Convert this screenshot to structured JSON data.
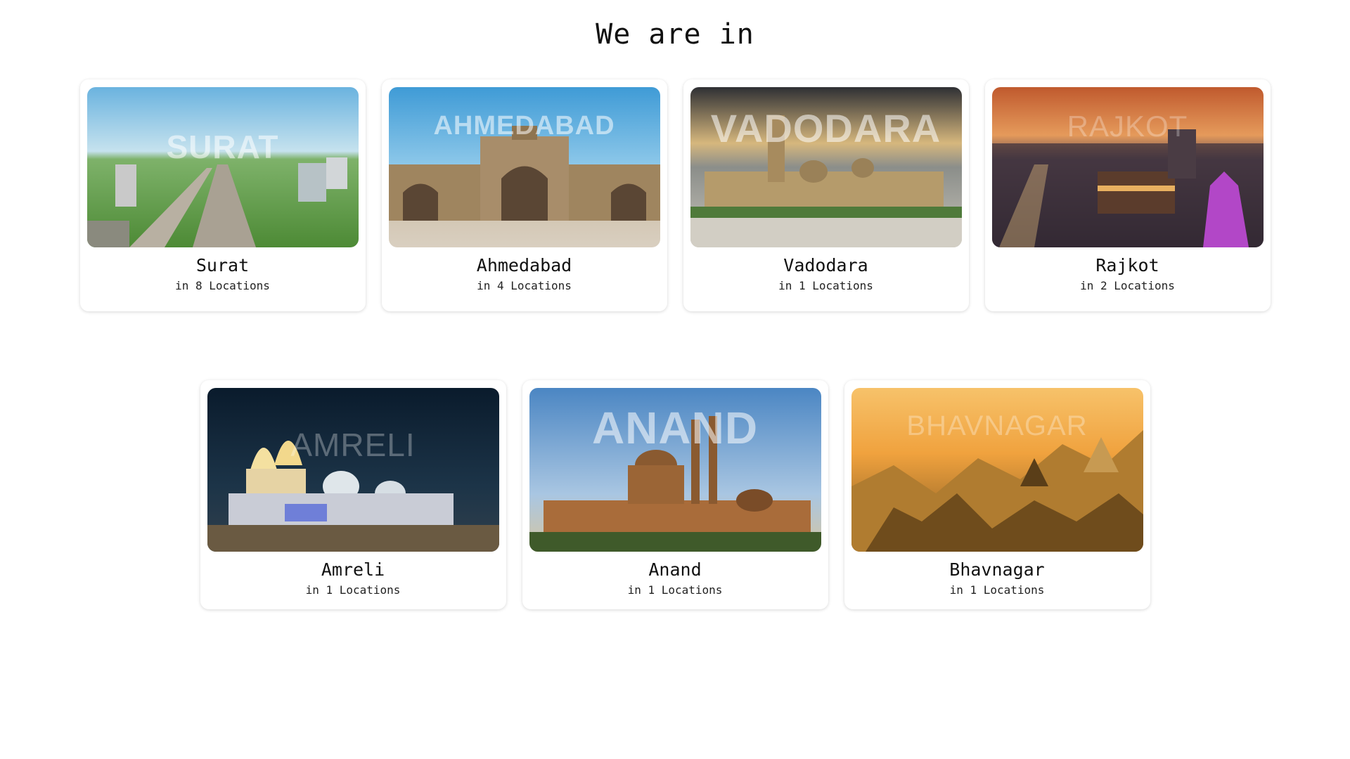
{
  "page": {
    "title": "We are in"
  },
  "cities": [
    {
      "name": "Surat",
      "overlay": "SURAT",
      "subtitle": "in 8 Locations",
      "colors": {
        "sky": "#7fc2e3",
        "ground": "#5f9e3d",
        "accent": "#b9b3a5"
      }
    },
    {
      "name": "Ahmedabad",
      "overlay": "AHMEDABAD",
      "subtitle": "in 4 Locations",
      "colors": {
        "sky": "#52a7d8",
        "ground": "#cfc3b0",
        "accent": "#a88d6a"
      }
    },
    {
      "name": "Vadodara",
      "overlay": "VADODARA",
      "subtitle": "in 1 Locations",
      "colors": {
        "sky": "#4a4a4e",
        "ground": "#b8b2a4",
        "accent": "#b59b6b"
      }
    },
    {
      "name": "Rajkot",
      "overlay": "RAJKOT",
      "subtitle": "in 2 Locations",
      "colors": {
        "sky": "#d4743c",
        "ground": "#2b2330",
        "accent": "#b247c7"
      }
    },
    {
      "name": "Amreli",
      "overlay": "AMRELI",
      "subtitle": "in 1 Locations",
      "colors": {
        "sky": "#0e2236",
        "ground": "#3c4d5c",
        "accent": "#f0e2b0"
      }
    },
    {
      "name": "Anand",
      "overlay": "ANAND",
      "subtitle": "in 1 Locations",
      "colors": {
        "sky": "#5b93cb",
        "ground": "#c7a25e",
        "accent": "#8a5a30"
      }
    },
    {
      "name": "Bhavnagar",
      "overlay": "BHAVNAGAR",
      "subtitle": "in 1 Locations",
      "colors": {
        "sky": "#f1a94a",
        "ground": "#8f6a2a",
        "accent": "#d8a25a"
      }
    }
  ]
}
